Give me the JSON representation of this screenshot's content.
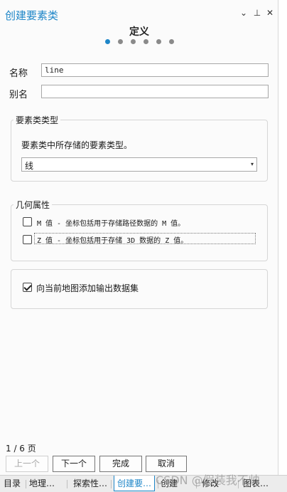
{
  "titlebar": {
    "title": "创建要素类",
    "menu_glyph": "⌄",
    "pin_glyph": "⊥",
    "close_glyph": "✕"
  },
  "step": {
    "title": "定义",
    "count": 6,
    "active_index": 0
  },
  "form": {
    "name_label": "名称",
    "name_value": "line",
    "alias_label": "别名",
    "alias_value": ""
  },
  "feature_type": {
    "legend": "要素类类型",
    "description": "要素类中所存储的要素类型。",
    "selected": "线",
    "caret": "▾"
  },
  "geometry": {
    "legend": "几何属性",
    "m_values": {
      "checked": false,
      "label": "M 值 - 坐标包括用于存储路径数据的 M 值。"
    },
    "z_values": {
      "checked": false,
      "label": "Z 值 - 坐标包括用于存储 3D 数据的 Z 值。"
    }
  },
  "add_to_map": {
    "checked": true,
    "label": "向当前地图添加输出数据集"
  },
  "footer": {
    "pager": "1 / 6 页",
    "prev": "上一个",
    "next": "下一个",
    "finish": "完成",
    "cancel": "取消"
  },
  "tabs": [
    {
      "label": "目录",
      "active": false
    },
    {
      "label": "地理…",
      "active": false
    },
    {
      "label": "探索性…",
      "active": false
    },
    {
      "label": "创建要…",
      "active": true
    },
    {
      "label": "创建",
      "active": false
    },
    {
      "label": "修改",
      "active": false
    },
    {
      "label": "图表…",
      "active": false
    }
  ],
  "watermark": "CSDN @假装我不帅",
  "colors": {
    "accent": "#1e86c8"
  }
}
